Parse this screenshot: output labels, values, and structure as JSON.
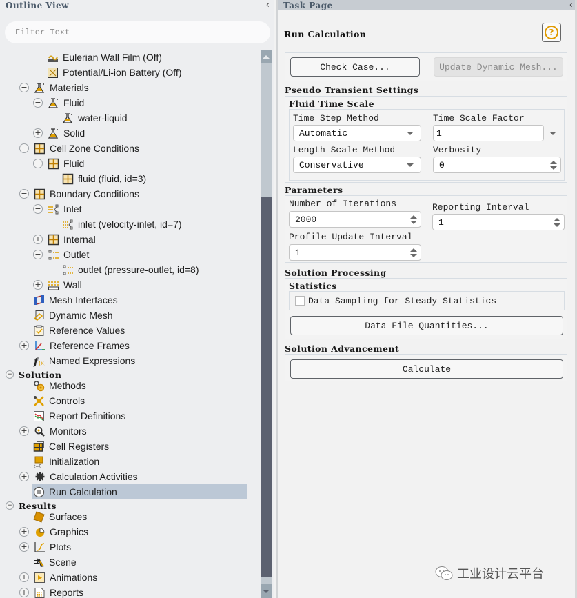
{
  "outline": {
    "title": "Outline View",
    "collapse_glyph": "‹",
    "filter_placeholder": "Filter Text",
    "items": [
      {
        "label": "Eulerian Wall Film (Off)",
        "icon": "wall-film-icon",
        "toggle": null
      },
      {
        "label": "Potential/Li-ion Battery (Off)",
        "icon": "battery-icon",
        "toggle": null
      },
      {
        "label": "Materials",
        "icon": "materials-flask-icon",
        "toggle": "−"
      },
      {
        "label": "Fluid",
        "icon": "materials-flask-icon",
        "toggle": "−"
      },
      {
        "label": "water-liquid",
        "icon": "materials-flask-icon",
        "toggle": null
      },
      {
        "label": "Solid",
        "icon": "materials-flask-icon",
        "toggle": "+"
      },
      {
        "label": "Cell Zone Conditions",
        "icon": "cell-zone-grid-icon",
        "toggle": "−"
      },
      {
        "label": "Fluid",
        "icon": "cell-zone-grid-icon",
        "toggle": "−"
      },
      {
        "label": "fluid (fluid, id=3)",
        "icon": "cell-zone-grid-icon",
        "toggle": null
      },
      {
        "label": "Boundary Conditions",
        "icon": "cell-zone-grid-icon",
        "toggle": "−"
      },
      {
        "label": "Inlet",
        "icon": "inlet-icon",
        "toggle": "−"
      },
      {
        "label": "inlet (velocity-inlet, id=7)",
        "icon": "inlet-icon",
        "toggle": null
      },
      {
        "label": "Internal",
        "icon": "cell-zone-grid-icon",
        "toggle": "+"
      },
      {
        "label": "Outlet",
        "icon": "outlet-icon",
        "toggle": "−"
      },
      {
        "label": "outlet (pressure-outlet, id=8)",
        "icon": "outlet-icon",
        "toggle": null
      },
      {
        "label": "Wall",
        "icon": "wall-icon",
        "toggle": "+"
      },
      {
        "label": "Mesh Interfaces",
        "icon": "mesh-interfaces-icon",
        "toggle": null
      },
      {
        "label": "Dynamic Mesh",
        "icon": "dynamic-mesh-icon",
        "toggle": null
      },
      {
        "label": "Reference Values",
        "icon": "reference-values-icon",
        "toggle": null
      },
      {
        "label": "Reference Frames",
        "icon": "reference-frames-icon",
        "toggle": "+"
      },
      {
        "label": "Named Expressions",
        "icon": "function-icon",
        "toggle": null
      },
      {
        "label": "Solution",
        "icon": null,
        "toggle": "−",
        "section": true
      },
      {
        "label": "Methods",
        "icon": "methods-icon",
        "toggle": null
      },
      {
        "label": "Controls",
        "icon": "controls-icon",
        "toggle": null
      },
      {
        "label": "Report Definitions",
        "icon": "report-definitions-icon",
        "toggle": null
      },
      {
        "label": "Monitors",
        "icon": "monitors-icon",
        "toggle": "+"
      },
      {
        "label": "Cell Registers",
        "icon": "cell-registers-icon",
        "toggle": null
      },
      {
        "label": "Initialization",
        "icon": "initialization-icon",
        "toggle": null
      },
      {
        "label": "Calculation Activities",
        "icon": "gear-icon",
        "toggle": "+"
      },
      {
        "label": "Run Calculation",
        "icon": "run-calculation-icon",
        "toggle": null,
        "selected": true
      },
      {
        "label": "Results",
        "icon": null,
        "toggle": "−",
        "section": true
      },
      {
        "label": "Surfaces",
        "icon": "surfaces-icon",
        "toggle": null
      },
      {
        "label": "Graphics",
        "icon": "graphics-icon",
        "toggle": "+"
      },
      {
        "label": "Plots",
        "icon": "plots-icon",
        "toggle": "+"
      },
      {
        "label": "Scene",
        "icon": "scene-icon",
        "toggle": null
      },
      {
        "label": "Animations",
        "icon": "animations-icon",
        "toggle": "+"
      },
      {
        "label": "Reports",
        "icon": "reports-icon",
        "toggle": "+"
      }
    ]
  },
  "task": {
    "title": "Task Page",
    "collapse_glyph": "‹",
    "page_title": "Run Calculation",
    "help_glyph": "?",
    "check_case_label": "Check Case...",
    "update_mesh_label": "Update Dynamic Mesh...",
    "pseudo_transient": {
      "title": "Pseudo Transient Settings",
      "fluid_time_scale": {
        "title": "Fluid Time Scale",
        "time_step_method": {
          "label": "Time Step Method",
          "value": "Automatic"
        },
        "time_scale_factor": {
          "label": "Time Scale Factor",
          "value": "1"
        },
        "length_scale_method": {
          "label": "Length Scale Method",
          "value": "Conservative"
        },
        "verbosity": {
          "label": "Verbosity",
          "value": "0"
        }
      }
    },
    "parameters": {
      "title": "Parameters",
      "iterations": {
        "label": "Number of Iterations",
        "value": "2000"
      },
      "reporting_interval": {
        "label": "Reporting Interval",
        "value": "1"
      },
      "profile_update_interval": {
        "label": "Profile Update Interval",
        "value": "1"
      }
    },
    "solution_processing": {
      "title": "Solution Processing",
      "statistics_title": "Statistics",
      "data_sampling_label": "Data Sampling for Steady Statistics",
      "data_sampling_checked": false,
      "data_file_quantities_label": "Data File Quantities..."
    },
    "solution_advancement": {
      "title": "Solution Advancement",
      "calculate_label": "Calculate"
    }
  },
  "watermark": {
    "text": "工业设计云平台",
    "icon": "wechat-icon"
  },
  "colors": {
    "selection": "#bcc8d6",
    "accent_orange": "#e09a00",
    "scroll_thumb": "#5c6170"
  }
}
